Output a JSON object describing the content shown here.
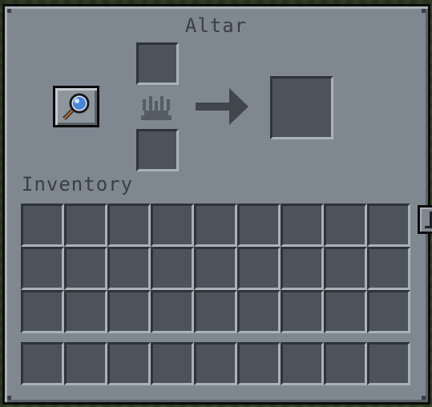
{
  "window": {
    "title": "Altar"
  },
  "inventory": {
    "label": "Inventory",
    "main_rows": 3,
    "columns": 9,
    "hotbar_slots": 9
  },
  "altar": {
    "tool_slot": {
      "item": "magnifying-glass-icon"
    },
    "input_top_slot": {
      "item": ""
    },
    "input_bottom_slot": {
      "item": ""
    },
    "output_slot": {
      "item": ""
    }
  },
  "colors": {
    "panel": "#7f8891",
    "slot": "#4c535a",
    "text": "#3b3f44",
    "arrow": "#40464c"
  }
}
